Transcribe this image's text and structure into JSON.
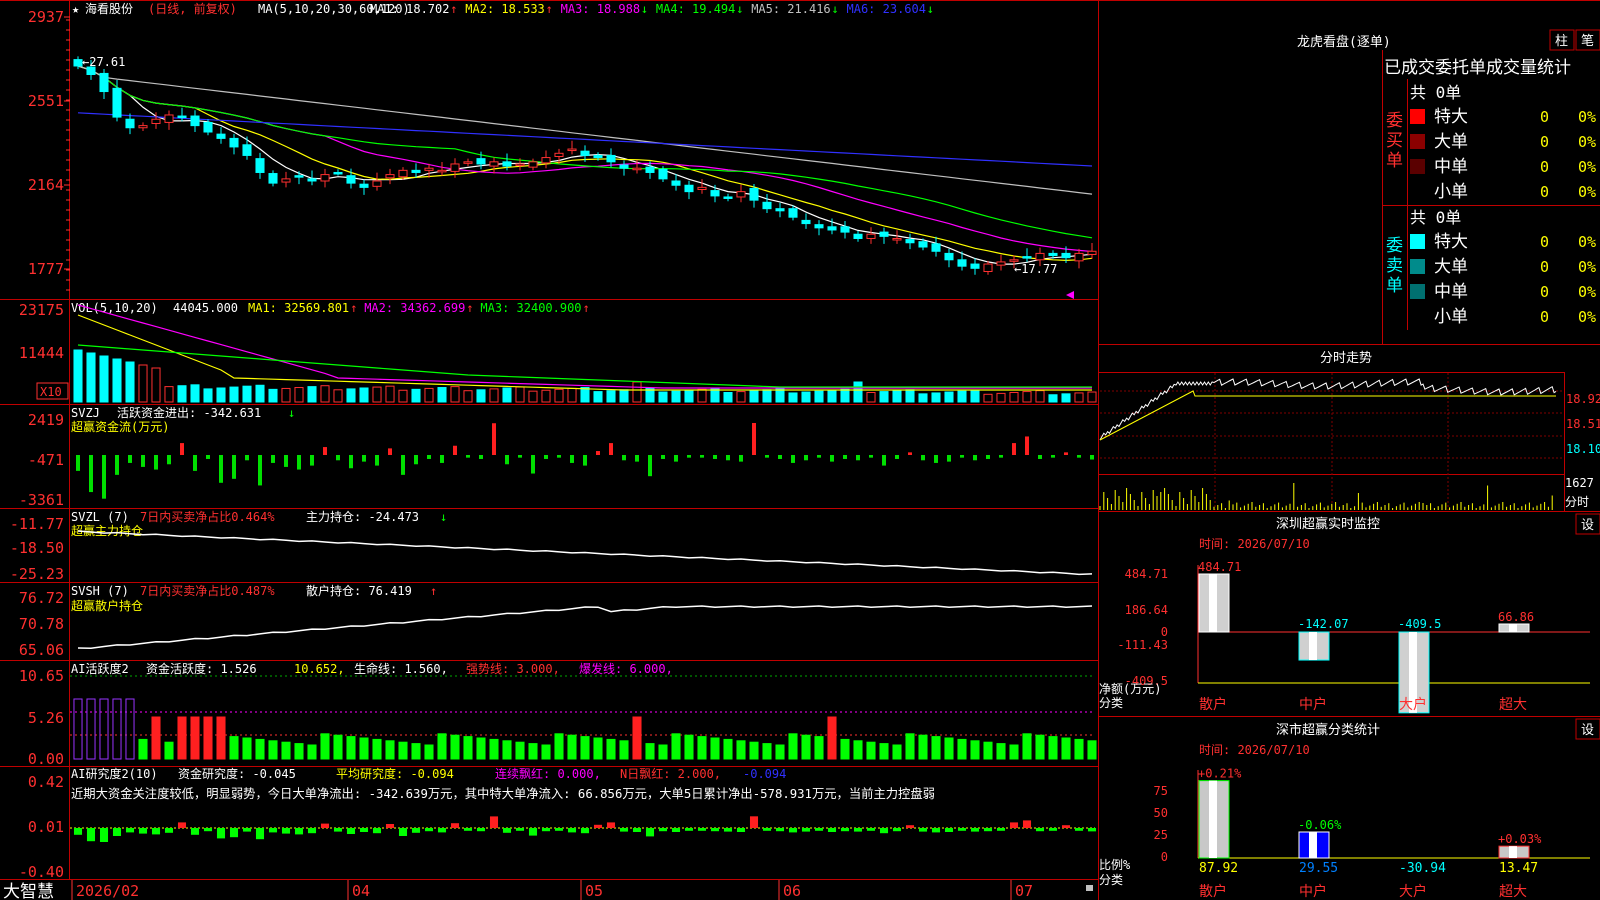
{
  "stock": {
    "name": "海看股份",
    "period": "(日线, 前复权)"
  },
  "main": {
    "ma_label": "MA(5,10,20,30,60,120)",
    "ma": [
      {
        "name": "MA1",
        "value": "18.702",
        "arrow": "↑",
        "color": "#ffffff"
      },
      {
        "name": "MA2",
        "value": "18.533",
        "arrow": "↑",
        "color": "#ffff00"
      },
      {
        "name": "MA3",
        "value": "18.988",
        "arrow": "↓",
        "color": "#ff00ff"
      },
      {
        "name": "MA4",
        "value": "19.494",
        "arrow": "↓",
        "color": "#00ff00"
      },
      {
        "name": "MA5",
        "value": "21.416",
        "arrow": "↓",
        "color": "#c0c0c0"
      },
      {
        "name": "MA6",
        "value": "23.604",
        "arrow": "↓",
        "color": "#3030ff"
      }
    ],
    "y_ticks": [
      "2937",
      "2551",
      "2164",
      "1777"
    ],
    "high_label": "←27.61",
    "low_label": "←17.77",
    "ylim": [
      16.6,
      29.7
    ]
  },
  "vol": {
    "label": "VOL(5,10,20)",
    "value": "44045.000",
    "ma": [
      {
        "name": "MA1",
        "value": "32569.801",
        "color": "#ffff00"
      },
      {
        "name": "MA2",
        "value": "34362.699",
        "color": "#ff00ff"
      },
      {
        "name": "MA3",
        "value": "32400.900",
        "color": "#00ff00"
      }
    ],
    "y_ticks": [
      "23175",
      "11444"
    ],
    "unit": "X10"
  },
  "svzj": {
    "label": "SVZJ",
    "line1": "活跃资金进出: -342.631",
    "arrow": "↓",
    "title": "超赢资金流(万元)",
    "y_ticks": [
      "2419",
      "-471",
      "-3361"
    ]
  },
  "svzl": {
    "label": "SVZL (7)",
    "ratio": "7日内买卖净占比0.464%",
    "hold": "主力持仓: -24.473",
    "arrow": "↓",
    "title": "超赢主力持仓",
    "y_ticks": [
      "-11.77",
      "-18.50",
      "-25.23"
    ]
  },
  "svsh": {
    "label": "SVSH (7)",
    "ratio": "7日内买卖净占比0.487%",
    "hold": "散户持仓: 76.419",
    "arrow": "↑",
    "title": "超赢散户持仓",
    "y_ticks": [
      "76.72",
      "70.78",
      "65.06"
    ]
  },
  "ai1": {
    "label": "AI活跃度2",
    "text1": "资金活跃度: 1.526",
    "text2": "10.652,",
    "text3": "生命线: 1.560,",
    "text4": "强势线: 3.000,",
    "text5": "爆发线: 6.000,",
    "y_ticks": [
      "10.65",
      "5.26",
      "0.00"
    ]
  },
  "ai2": {
    "label": "AI研究度2(10)",
    "text1": "资金研究度: -0.045",
    "text2": "平均研究度: -0.094",
    "text3": "连续飘红: 0.000,",
    "text4": "N日飘红: 2.000,",
    "text5": "-0.094",
    "comment": "近期大资金关注度较低，明显弱势，今日大单净流出: -342.639万元，其中特大单净流入: 66.856万元，大单5日累计净出-578.931万元，当前主力控盘弱",
    "y_ticks": [
      "0.42",
      "0.01",
      "-0.40"
    ]
  },
  "bottom": {
    "logo": "大智慧",
    "dates": [
      "2026/02",
      "04",
      "05",
      "06",
      "07"
    ]
  },
  "lhb": {
    "title": "龙虎看盘(逐单)",
    "btn1": "柱",
    "btn2": "笔",
    "header": "已成交委托单成交量统计",
    "buy_total": "共 0单",
    "buy_label": "委买单",
    "sell_total": "共 0单",
    "sell_label": "委卖单",
    "buy_rows": [
      {
        "name": "特大",
        "count": "0",
        "pct": "0%",
        "color": "#ff0000"
      },
      {
        "name": "大单",
        "count": "0",
        "pct": "0%",
        "color": "#8b0000"
      },
      {
        "name": "中单",
        "count": "0",
        "pct": "0%",
        "color": "#5a0000"
      },
      {
        "name": "小单",
        "count": "0",
        "pct": "0%",
        "color": "#000000"
      }
    ],
    "sell_rows": [
      {
        "name": "特大",
        "count": "0",
        "pct": "0%",
        "color": "#00ffff"
      },
      {
        "name": "大单",
        "count": "0",
        "pct": "0%",
        "color": "#008b8b"
      },
      {
        "name": "中单",
        "count": "0",
        "pct": "0%",
        "color": "#007070"
      },
      {
        "name": "小单",
        "count": "0",
        "pct": "0%",
        "color": "#000000"
      }
    ]
  },
  "intraday": {
    "title": "分时走势",
    "y_ticks": [
      "18.92",
      "18.51",
      "18.10"
    ],
    "vol_tick": "1627",
    "vol_label": "分时"
  },
  "monitor": {
    "title": "深圳超赢实时监控",
    "btn": "设",
    "time": "时间: 2026/07/10",
    "y_ticks": [
      "484.71",
      "186.64",
      "0",
      "-111.43",
      "-409.5"
    ],
    "ylabel": "净额(万元)",
    "xlabel": "分类",
    "categories": [
      "散户",
      "中户",
      "大户",
      "超大"
    ],
    "values": [
      484.71,
      -142.07,
      -409.5,
      66.86
    ],
    "value_labels": [
      "484.71",
      "-142.07",
      "-409.5",
      "66.86"
    ]
  },
  "classify": {
    "title": "深市超赢分类统计",
    "btn": "设",
    "time": "时间: 2026/07/10",
    "y_ticks": [
      "75",
      "50",
      "25",
      "0"
    ],
    "ylabel": "比例%",
    "xlabel": "分类",
    "categories": [
      "散户",
      "中户",
      "大户",
      "超大"
    ],
    "bar_values": [
      0.21,
      -0.06,
      0,
      0.03
    ],
    "bar_labels": [
      "+0.21%",
      "-0.06%",
      "",
      "+0.03%"
    ],
    "values": [
      "87.92",
      "29.55",
      "-30.94",
      "13.47"
    ]
  },
  "chart_data": {
    "type": "candlestick",
    "title": "海看股份 (日线, 前复权)",
    "x_ticks": [
      "2026/02",
      "04",
      "05",
      "06",
      "07"
    ],
    "price_range": [
      17.77,
      27.61
    ],
    "close_approx": [
      27.4,
      27.0,
      26.2,
      25.0,
      24.5,
      24.6,
      24.9,
      25.1,
      25.0,
      24.6,
      24.3,
      24.0,
      23.6,
      23.2,
      22.4,
      21.9,
      22.1,
      22.2,
      22.0,
      22.3,
      22.4,
      21.9,
      21.7,
      22.0,
      22.3,
      22.5,
      22.4,
      22.6,
      22.5,
      22.8,
      22.9,
      22.8,
      22.9,
      22.7,
      22.8,
      22.9,
      23.1,
      23.3,
      23.5,
      23.2,
      23.1,
      22.9,
      22.6,
      22.6,
      22.4,
      22.1,
      21.8,
      21.5,
      21.7,
      21.3,
      21.2,
      21.5,
      21.1,
      20.7,
      20.6,
      20.3,
      20.0,
      19.8,
      19.7,
      19.6,
      19.3,
      19.5,
      19.4,
      19.3,
      19.1,
      18.9,
      18.7,
      18.3,
      18.0,
      17.9,
      18.1,
      18.2,
      18.3,
      18.4,
      18.6,
      18.5,
      18.4,
      18.6,
      18.7
    ],
    "svzj_values": [
      -1200,
      -2800,
      -3300,
      -1500,
      -600,
      -900,
      -1100,
      -700,
      900,
      -1200,
      -300,
      -2100,
      -1800,
      -400,
      -2300,
      -600,
      -900,
      -1100,
      -800,
      600,
      -400,
      -1000,
      -500,
      -800,
      500,
      -1500,
      -700,
      -300,
      -600,
      700,
      -200,
      -300,
      2400,
      -700,
      -200,
      -1400,
      -300,
      -200,
      -600,
      -800,
      300,
      900,
      -400,
      -500,
      -1600,
      -300,
      -500,
      -200,
      -200,
      -300,
      -400,
      -500,
      2419,
      -200,
      -300,
      -600,
      -400,
      -200,
      -500,
      -300,
      -400,
      -200,
      -800,
      -300,
      200,
      -400,
      -600,
      -500,
      -200,
      -400,
      -300,
      -200,
      900,
      1400,
      -300,
      -200,
      200,
      -200,
      -342.6
    ],
    "vol_ma": [
      {
        "name": "MA1",
        "value": 32569.801
      },
      {
        "name": "MA2",
        "value": 34362.699
      },
      {
        "name": "MA3",
        "value": 32400.9
      }
    ]
  }
}
